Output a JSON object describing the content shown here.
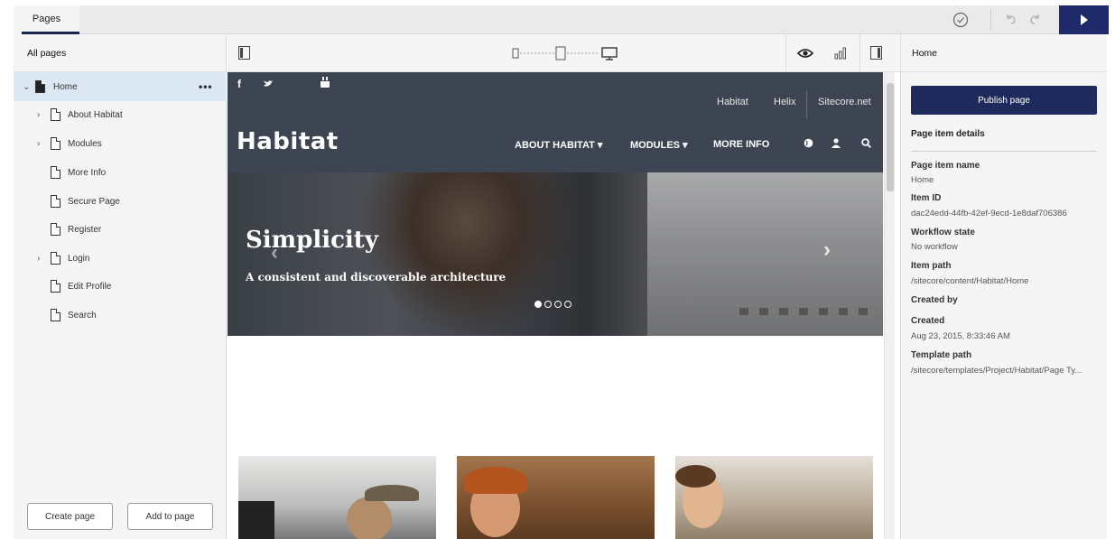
{
  "topbar": {
    "tab_label": "Pages",
    "accent": "#1f2a6b"
  },
  "left_panel": {
    "title": "All pages",
    "tree": [
      {
        "label": "Home",
        "expanded": true,
        "selected": true
      },
      {
        "label": "About Habitat",
        "has_children": true
      },
      {
        "label": "Modules",
        "has_children": true
      },
      {
        "label": "More Info",
        "has_children": false
      },
      {
        "label": "Secure Page",
        "has_children": false
      },
      {
        "label": "Register",
        "has_children": false
      },
      {
        "label": "Login",
        "has_children": true
      },
      {
        "label": "Edit Profile",
        "has_children": false
      },
      {
        "label": "Search",
        "has_children": false
      }
    ],
    "create_button": "Create page",
    "add_button": "Add to page"
  },
  "preview": {
    "social": [
      "f",
      "y",
      "yt"
    ],
    "top_links": [
      "Habitat",
      "Helix",
      "Sitecore.net"
    ],
    "logo": "Habitat",
    "nav": [
      "ABOUT HABITAT",
      "MODULES",
      "MORE INFO"
    ],
    "hero_title": "Simplicity",
    "hero_subtitle": "A consistent and discoverable architecture",
    "carousel_slides": 4,
    "carousel_active": 1
  },
  "right_panel": {
    "title": "Home",
    "publish_button": "Publish page",
    "section_title": "Page item details",
    "details": [
      {
        "label": "Page item name",
        "value": "Home"
      },
      {
        "label": "Item ID",
        "value": "dac24edd-44fb-42ef-9ecd-1e8daf706386"
      },
      {
        "label": "Workflow state",
        "value": "No workflow"
      },
      {
        "label": "Item path",
        "value": "/sitecore/content/Habitat/Home"
      },
      {
        "label": "Created by",
        "value": ""
      },
      {
        "label": "Created",
        "value": "Aug 23, 2015, 8:33:46 AM"
      },
      {
        "label": "Template path",
        "value": "/sitecore/templates/Project/Habitat/Page Ty..."
      }
    ]
  }
}
